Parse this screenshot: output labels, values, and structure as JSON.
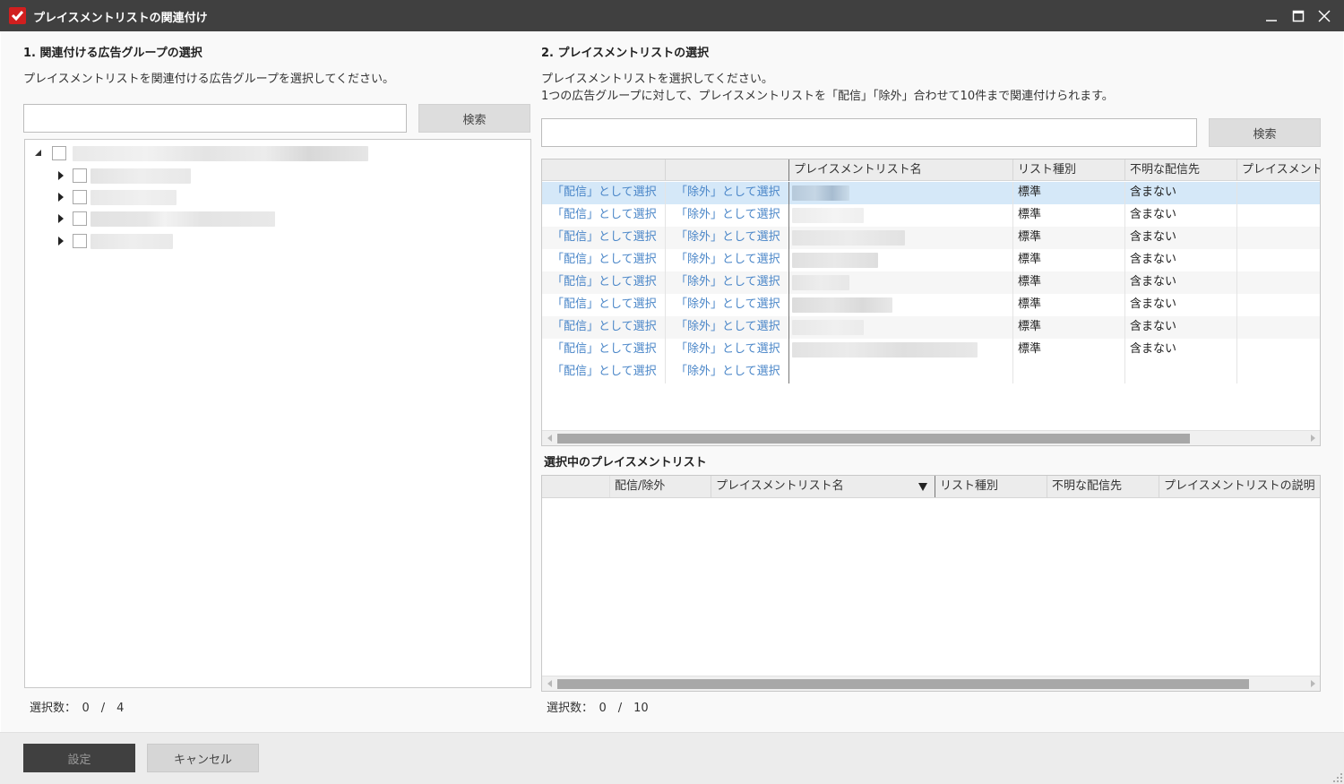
{
  "window": {
    "title": "プレイスメントリストの関連付け",
    "brand_color": "#d11f1f"
  },
  "left": {
    "heading": "1. 関連付ける広告グループの選択",
    "description": "プレイスメントリストを関連付ける広告グループを選択してください。",
    "search_value": "",
    "search_button": "検索",
    "counter": "選択数：　0　/　4"
  },
  "right": {
    "heading": "2. プレイスメントリストの選択",
    "description_line1": "プレイスメントリストを選択してください。",
    "description_line2": "1つの広告グループに対して、プレイスメントリストを「配信」「除外」合わせて10件まで関連付けられます。",
    "search_value": "",
    "search_button": "検索",
    "columns": [
      "",
      "",
      "プレイスメントリスト名",
      "リスト種別",
      "不明な配信先",
      "プレイスメント"
    ],
    "rows": [
      {
        "deliver": "「配信」として選択",
        "exclude": "「除外」として選択",
        "type": "標準",
        "unknown": "含まない",
        "selected": true
      },
      {
        "deliver": "「配信」として選択",
        "exclude": "「除外」として選択",
        "type": "標準",
        "unknown": "含まない"
      },
      {
        "deliver": "「配信」として選択",
        "exclude": "「除外」として選択",
        "type": "標準",
        "unknown": "含まない"
      },
      {
        "deliver": "「配信」として選択",
        "exclude": "「除外」として選択",
        "type": "標準",
        "unknown": "含まない"
      },
      {
        "deliver": "「配信」として選択",
        "exclude": "「除外」として選択",
        "type": "標準",
        "unknown": "含まない"
      },
      {
        "deliver": "「配信」として選択",
        "exclude": "「除外」として選択",
        "type": "標準",
        "unknown": "含まない"
      },
      {
        "deliver": "「配信」として選択",
        "exclude": "「除外」として選択",
        "type": "標準",
        "unknown": "含まない"
      },
      {
        "deliver": "「配信」として選択",
        "exclude": "「除外」として選択",
        "type": "標準",
        "unknown": "含まない"
      },
      {
        "deliver": "「配信」として選択",
        "exclude": "「除外」として選択",
        "type": "",
        "unknown": ""
      }
    ],
    "selected_heading": "選択中のプレイスメントリスト",
    "selected_columns": [
      "",
      "配信/除外",
      "プレイスメントリスト名",
      "リスト種別",
      "不明な配信先",
      "プレイスメントリストの説明"
    ],
    "counter": "選択数：　0　/　10"
  },
  "footer": {
    "set_button": "設定",
    "cancel_button": "キャンセル"
  },
  "colors": {
    "link": "#4a86c8",
    "selected_row": "#d5e8f8",
    "titlebar": "#404040"
  }
}
